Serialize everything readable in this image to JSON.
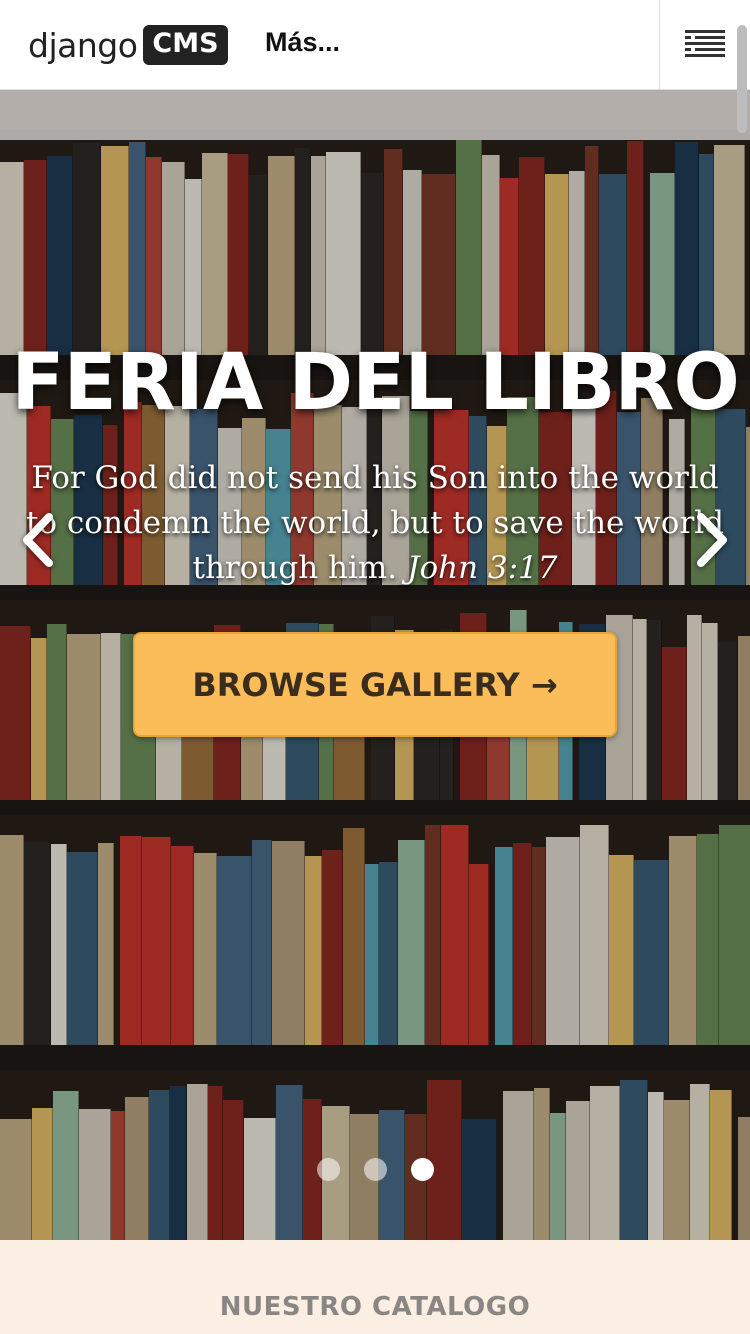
{
  "toolbar": {
    "logo_word": "django",
    "logo_badge": "CMS",
    "more_label": "Más...",
    "menu_icon": "hamburger-menu-icon"
  },
  "hero": {
    "title": "FERIA DEL LIBRO",
    "quote": "For God did not send his Son into the world to condemn the world, but to save the world through him.",
    "reference": "John 3:17",
    "cta_label": "BROWSE GALLERY →",
    "prev_icon": "chevron-left-icon",
    "next_icon": "chevron-right-icon",
    "slides_count": 3,
    "active_slide": 3,
    "accent_color": "#fbbd59"
  },
  "catalog": {
    "title": "NUESTRO CATALOGO"
  }
}
